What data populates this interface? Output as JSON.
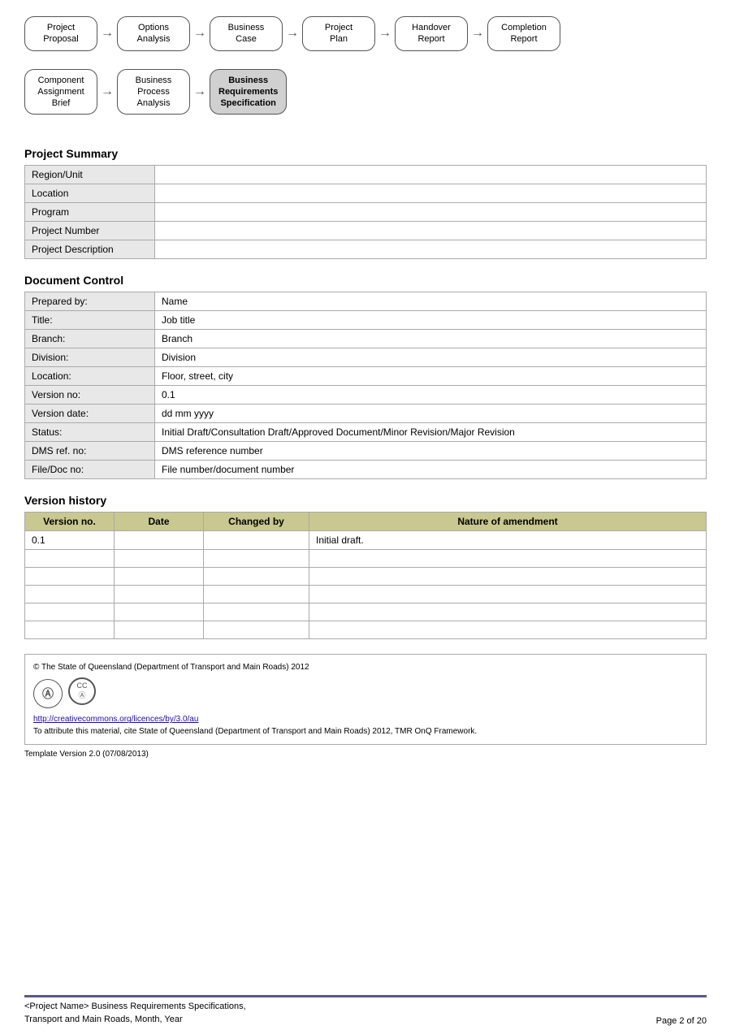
{
  "flow1": {
    "steps": [
      {
        "id": "project-proposal",
        "label": "Project\nProposal",
        "highlighted": false
      },
      {
        "id": "options-analysis",
        "label": "Options\nAnalysis",
        "highlighted": false
      },
      {
        "id": "business-case",
        "label": "Business\nCase",
        "highlighted": false
      },
      {
        "id": "project-plan",
        "label": "Project\nPlan",
        "highlighted": false
      },
      {
        "id": "handover-report",
        "label": "Handover\nReport",
        "highlighted": false
      },
      {
        "id": "completion-report",
        "label": "Completion\nReport",
        "highlighted": false
      }
    ]
  },
  "flow2": {
    "steps": [
      {
        "id": "component-assignment-brief",
        "label": "Component\nAssignment\nBrief",
        "highlighted": false
      },
      {
        "id": "business-process-analysis",
        "label": "Business\nProcess\nAnalysis",
        "highlighted": false
      },
      {
        "id": "business-requirements-specification",
        "label": "Business\nRequirements\nSpecification",
        "highlighted": true
      }
    ]
  },
  "project_summary": {
    "heading": "Project Summary",
    "fields": [
      {
        "label": "Region/Unit",
        "value": ""
      },
      {
        "label": "Location",
        "value": ""
      },
      {
        "label": "Program",
        "value": ""
      },
      {
        "label": "Project Number",
        "value": ""
      },
      {
        "label": "Project Description",
        "value": ""
      }
    ]
  },
  "document_control": {
    "heading": "Document Control",
    "fields": [
      {
        "label": "Prepared by:",
        "value": "Name"
      },
      {
        "label": "Title:",
        "value": "Job title"
      },
      {
        "label": "Branch:",
        "value": "Branch"
      },
      {
        "label": "Division:",
        "value": "Division"
      },
      {
        "label": "Location:",
        "value": "Floor, street, city"
      },
      {
        "label": "Version no:",
        "value": "0.1"
      },
      {
        "label": "Version date:",
        "value": "dd mm yyyy"
      },
      {
        "label": "Status:",
        "value": "Initial Draft/Consultation Draft/Approved Document/Minor Revision/Major Revision"
      },
      {
        "label": "DMS ref. no:",
        "value": "DMS reference number"
      },
      {
        "label": "File/Doc no:",
        "value": "File number/document number"
      }
    ]
  },
  "version_history": {
    "heading": "Version history",
    "columns": [
      "Version no.",
      "Date",
      "Changed by",
      "Nature of amendment"
    ],
    "rows": [
      {
        "version": "0.1",
        "date": "",
        "changed_by": "",
        "amendment": "Initial draft."
      },
      {
        "version": "",
        "date": "",
        "changed_by": "",
        "amendment": ""
      },
      {
        "version": "",
        "date": "",
        "changed_by": "",
        "amendment": ""
      },
      {
        "version": "",
        "date": "",
        "changed_by": "",
        "amendment": ""
      },
      {
        "version": "",
        "date": "",
        "changed_by": "",
        "amendment": ""
      },
      {
        "version": "",
        "date": "",
        "changed_by": "",
        "amendment": ""
      }
    ]
  },
  "footer": {
    "copyright": "© The State of Queensland (Department of Transport and Main Roads) 2012",
    "cc_link": "http://creativecommons.org/licences/by/3.0/au",
    "attribution": "To attribute this material, cite State of Queensland (Department of Transport and Main Roads) 2012, TMR OnQ Framework.",
    "template_version": "Template Version 2.0 (07/08/2013)"
  },
  "page_footer": {
    "left_line1": "<Project Name> Business Requirements Specifications,",
    "left_line2": "Transport and Main Roads, Month, Year",
    "right": "Page 2 of 20"
  }
}
